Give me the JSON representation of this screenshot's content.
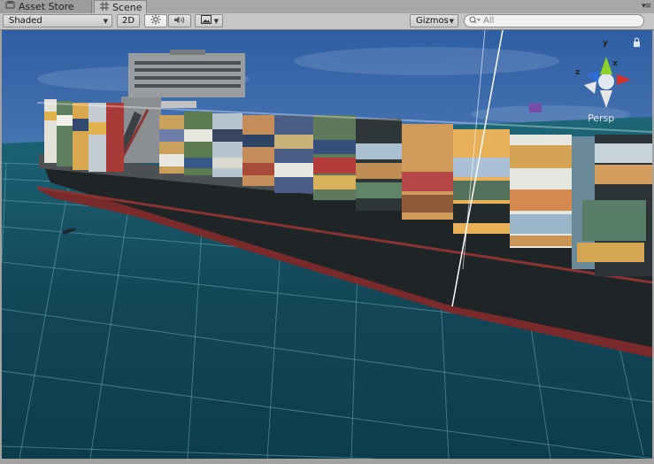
{
  "tabs": [
    {
      "label": "Asset Store",
      "icon": "cart-icon"
    },
    {
      "label": "Scene",
      "icon": "grid-icon"
    }
  ],
  "toolbar": {
    "draw_mode": "Shaded",
    "mode_2d": "2D",
    "lighting_icon": "sun-icon",
    "audio_icon": "speaker-icon",
    "effects_icon": "image-icon",
    "gizmos": "Gizmos",
    "search_placeholder": "All"
  },
  "gizmo": {
    "y": "y",
    "x": "x",
    "z": "z",
    "projection": "Persp",
    "lock_icon": "lock-icon"
  },
  "colors": {
    "sky_top": "#2f5ea4",
    "sky_horizon": "#8fb5d2",
    "water": "#14495a",
    "hull": "#1f2426",
    "hull_stripe": "#8a3333",
    "axis_x": "#d8312a",
    "axis_y": "#8fd02a",
    "axis_z": "#2f6cd8"
  }
}
